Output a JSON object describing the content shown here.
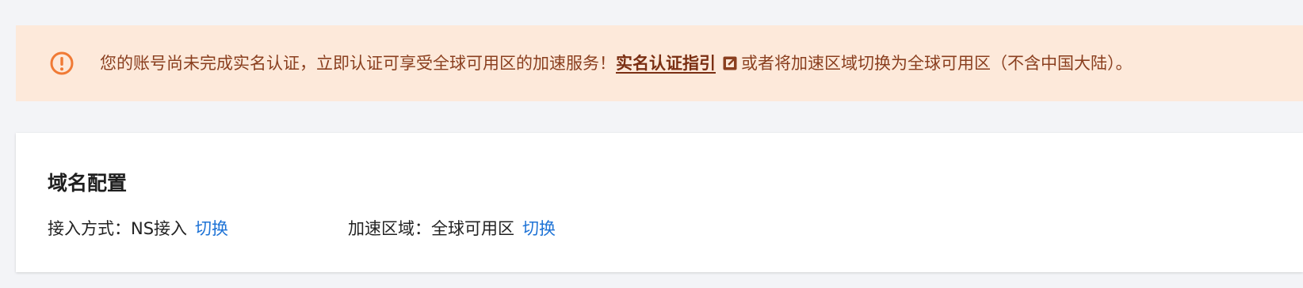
{
  "notice": {
    "message": "您的账号尚未完成实名认证，立即认证可享受全球可用区的加速服务！",
    "link_label": "实名认证指引",
    "suffix": "或者将加速区域切换为全球可用区（不含中国大陆）。",
    "icon": "warning-circle-icon",
    "link_icon": "external-link-icon",
    "colors": {
      "background": "#fde9da",
      "icon": "#f07a35",
      "text": "#8a3f1f",
      "link": "#7a2e12"
    }
  },
  "domain_config": {
    "title": "域名配置",
    "access_method": {
      "label": "接入方式：",
      "value": "NS接入",
      "action": "切换"
    },
    "acceleration_region": {
      "label": "加速区域：",
      "value": "全球可用区",
      "action": "切换"
    },
    "link_color": "#1e73d6"
  }
}
